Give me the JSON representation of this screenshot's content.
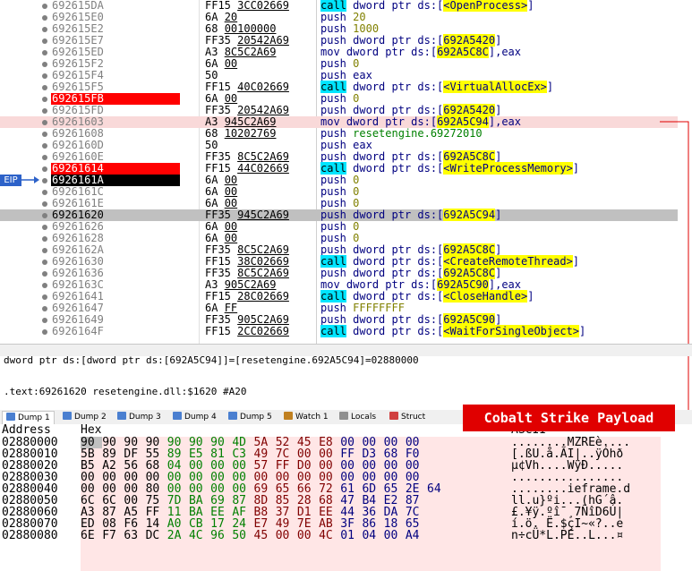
{
  "disasm_rows": [
    {
      "addr": "692615DA",
      "bytes": "FF15 3CC02669",
      "mn": "call",
      "args": "dword ptr ds:[",
      "ref": "<OpenProcess>",
      "tail": "]",
      "style": "call",
      "mark": ""
    },
    {
      "addr": "692615E0",
      "bytes": "6A 20",
      "mn": "push",
      "args": "",
      "num": "20",
      "style": "push",
      "mark": ""
    },
    {
      "addr": "692615E2",
      "bytes": "68 00100000",
      "mn": "push",
      "args": "",
      "num": "1000",
      "style": "push",
      "mark": ""
    },
    {
      "addr": "692615E7",
      "bytes": "FF35 20542A69",
      "mn": "push",
      "args": "dword ptr ds:[",
      "ref": "692A5420",
      "tail": "]",
      "style": "push",
      "mark": ""
    },
    {
      "addr": "692615ED",
      "bytes": "A3 8C5C2A69",
      "mn": "mov",
      "args": "dword ptr ds:[",
      "ref": "692A5C8C",
      "tail": "],eax",
      "style": "mov",
      "mark": ""
    },
    {
      "addr": "692615F2",
      "bytes": "6A 00",
      "mn": "push",
      "args": "",
      "num": "0",
      "style": "push",
      "mark": ""
    },
    {
      "addr": "692615F4",
      "bytes": "50",
      "mn": "push",
      "args": "eax",
      "style": "push",
      "mark": ""
    },
    {
      "addr": "692615F5",
      "bytes": "FF15 40C02669",
      "mn": "call",
      "args": "dword ptr ds:[",
      "ref": "<VirtualAllocEx>",
      "tail": "]",
      "style": "call",
      "mark": ""
    },
    {
      "addr": "692615FB",
      "bytes": "6A 00",
      "mn": "push",
      "args": "",
      "num": "0",
      "style": "push",
      "mark": "bp"
    },
    {
      "addr": "692615FD",
      "bytes": "FF35 20542A69",
      "mn": "push",
      "args": "dword ptr ds:[",
      "ref": "692A5420",
      "tail": "]",
      "style": "push",
      "mark": ""
    },
    {
      "addr": "69261603",
      "bytes": "A3 945C2A69",
      "mn": "mov",
      "args": "dword ptr ds:[",
      "ref": "692A5C94",
      "tail": "],eax",
      "style": "mov",
      "mark": "pink"
    },
    {
      "addr": "69261608",
      "bytes": "68 10202769",
      "mn": "push",
      "args": "resetengine.69272010",
      "style": "pushsym",
      "mark": ""
    },
    {
      "addr": "6926160D",
      "bytes": "50",
      "mn": "push",
      "args": "eax",
      "style": "push",
      "mark": ""
    },
    {
      "addr": "6926160E",
      "bytes": "FF35 8C5C2A69",
      "mn": "push",
      "args": "dword ptr ds:[",
      "ref": "692A5C8C",
      "tail": "]",
      "style": "push",
      "mark": ""
    },
    {
      "addr": "69261614",
      "bytes": "FF15 44C02669",
      "mn": "call",
      "args": "dword ptr ds:[",
      "ref": "<WriteProcessMemory>",
      "tail": "]",
      "style": "call",
      "mark": "bp"
    },
    {
      "addr": "6926161A",
      "bytes": "6A 00",
      "mn": "push",
      "args": "",
      "num": "0",
      "style": "push",
      "mark": "eip"
    },
    {
      "addr": "6926161C",
      "bytes": "6A 00",
      "mn": "push",
      "args": "",
      "num": "0",
      "style": "push",
      "mark": ""
    },
    {
      "addr": "6926161E",
      "bytes": "6A 00",
      "mn": "push",
      "args": "",
      "num": "0",
      "style": "push",
      "mark": ""
    },
    {
      "addr": "69261620",
      "bytes": "FF35 945C2A69",
      "mn": "push",
      "args": "dword ptr ds:[",
      "ref": "692A5C94",
      "tail": "]",
      "style": "push",
      "mark": "gray"
    },
    {
      "addr": "69261626",
      "bytes": "6A 00",
      "mn": "push",
      "args": "",
      "num": "0",
      "style": "push",
      "mark": ""
    },
    {
      "addr": "69261628",
      "bytes": "6A 00",
      "mn": "push",
      "args": "",
      "num": "0",
      "style": "push",
      "mark": ""
    },
    {
      "addr": "6926162A",
      "bytes": "FF35 8C5C2A69",
      "mn": "push",
      "args": "dword ptr ds:[",
      "ref": "692A5C8C",
      "tail": "]",
      "style": "push",
      "mark": ""
    },
    {
      "addr": "69261630",
      "bytes": "FF15 38C02669",
      "mn": "call",
      "args": "dword ptr ds:[",
      "ref": "<CreateRemoteThread>",
      "tail": "]",
      "style": "call",
      "mark": ""
    },
    {
      "addr": "69261636",
      "bytes": "FF35 8C5C2A69",
      "mn": "push",
      "args": "dword ptr ds:[",
      "ref": "692A5C8C",
      "tail": "]",
      "style": "push",
      "mark": ""
    },
    {
      "addr": "6926163C",
      "bytes": "A3 905C2A69",
      "mn": "mov",
      "args": "dword ptr ds:[",
      "ref": "692A5C90",
      "tail": "],eax",
      "style": "mov",
      "mark": ""
    },
    {
      "addr": "69261641",
      "bytes": "FF15 28C02669",
      "mn": "call",
      "args": "dword ptr ds:[",
      "ref": "<CloseHandle>",
      "tail": "]",
      "style": "call",
      "mark": ""
    },
    {
      "addr": "69261647",
      "bytes": "6A FF",
      "mn": "push",
      "args": "",
      "num": "FFFFFFFF",
      "style": "push",
      "mark": ""
    },
    {
      "addr": "69261649",
      "bytes": "FF35 905C2A69",
      "mn": "push",
      "args": "dword ptr ds:[",
      "ref": "692A5C90",
      "tail": "]",
      "style": "push",
      "mark": ""
    },
    {
      "addr": "6926164F",
      "bytes": "FF15 2CC02669",
      "mn": "call",
      "args": "dword ptr ds:[",
      "ref": "<WaitForSingleObject>",
      "tail": "]",
      "style": "call",
      "mark": ""
    }
  ],
  "eip_label": "EIP",
  "info_line_1": "dword ptr ds:[dword ptr ds:[692A5C94]]=[resetengine.692A5C94]=02880000",
  "info_line_2": ".text:69261620 resetengine.dll:$1620 #A20",
  "tabs": [
    {
      "label": "Dump 1",
      "color": "#4a7fd0"
    },
    {
      "label": "Dump 2",
      "color": "#4a7fd0"
    },
    {
      "label": "Dump 3",
      "color": "#4a7fd0"
    },
    {
      "label": "Dump 4",
      "color": "#4a7fd0"
    },
    {
      "label": "Dump 5",
      "color": "#4a7fd0"
    },
    {
      "label": "Watch 1",
      "color": "#c08020"
    },
    {
      "label": "Locals",
      "color": "#909090"
    },
    {
      "label": "Struct",
      "color": "#d04040"
    }
  ],
  "payload_label": "Cobalt Strike Payload",
  "dump_header": {
    "address": "Address",
    "hex": "Hex",
    "ascii": "ASCII"
  },
  "dump_rows": [
    {
      "addr": "02880000",
      "hex": [
        "90",
        "90",
        "90",
        "90",
        "90",
        "90",
        "90",
        "4D",
        "5A",
        "52",
        "45",
        "E8",
        "00",
        "00",
        "00",
        "00"
      ],
      "ascii": "........MZREè...."
    },
    {
      "addr": "02880010",
      "hex": [
        "5B",
        "89",
        "DF",
        "55",
        "89",
        "E5",
        "81",
        "C3",
        "49",
        "7C",
        "00",
        "00",
        "FF",
        "D3",
        "68",
        "F0"
      ],
      "ascii": "[.ßU.å.ÃI|..ÿÓhð"
    },
    {
      "addr": "02880020",
      "hex": [
        "B5",
        "A2",
        "56",
        "68",
        "04",
        "00",
        "00",
        "00",
        "57",
        "FF",
        "D0",
        "00",
        "00",
        "00",
        "00",
        "00"
      ],
      "ascii": "µ¢Vh....WÿÐ....."
    },
    {
      "addr": "02880030",
      "hex": [
        "00",
        "00",
        "00",
        "00",
        "00",
        "00",
        "00",
        "00",
        "00",
        "00",
        "00",
        "00",
        "00",
        "00",
        "00",
        "00"
      ],
      "ascii": "................"
    },
    {
      "addr": "02880040",
      "hex": [
        "00",
        "00",
        "00",
        "80",
        "00",
        "00",
        "00",
        "00",
        "69",
        "65",
        "66",
        "72",
        "61",
        "6D",
        "65",
        "2E",
        "64"
      ],
      "ascii": "........ieframe.d"
    },
    {
      "addr": "02880050",
      "hex": [
        "6C",
        "6C",
        "00",
        "75",
        "7D",
        "BA",
        "69",
        "87",
        "8D",
        "85",
        "28",
        "68",
        "47",
        "B4",
        "E2",
        "87"
      ],
      "ascii": "ll.u}ºi...(hG´â."
    },
    {
      "addr": "02880060",
      "hex": [
        "A3",
        "87",
        "A5",
        "FF",
        "11",
        "BA",
        "EE",
        "AF",
        "B8",
        "37",
        "D1",
        "EE",
        "44",
        "36",
        "DA",
        "7C"
      ],
      "ascii": "£.¥ÿ.ºî¯¸7ÑîD6Ú|"
    },
    {
      "addr": "02880070",
      "hex": [
        "ED",
        "08",
        "F6",
        "14",
        "A0",
        "CB",
        "17",
        "24",
        "E7",
        "49",
        "7E",
        "AB",
        "3F",
        "86",
        "18",
        "65"
      ],
      "ascii": "í.ö. Ë.$çI~«?..e"
    },
    {
      "addr": "02880080",
      "hex": [
        "6E",
        "F7",
        "63",
        "DC",
        "2A",
        "4C",
        "96",
        "50",
        "45",
        "00",
        "00",
        "4C",
        "01",
        "04",
        "00",
        "A4"
      ],
      "ascii": "n÷cÜ*L.PE..L...¤"
    }
  ]
}
